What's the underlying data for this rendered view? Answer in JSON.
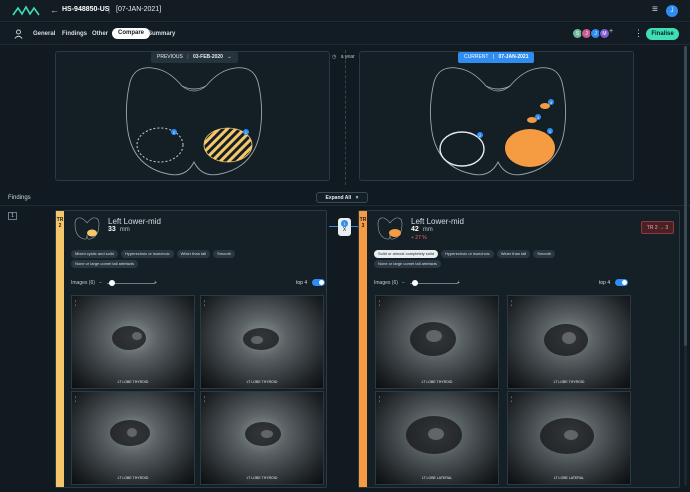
{
  "header": {
    "patient_id": "HS-948850-US",
    "separator": "|",
    "study_date": "[07-JAN-2021]",
    "user_initial": "J"
  },
  "nav": {
    "tabs": [
      {
        "label": "General",
        "active": false
      },
      {
        "label": "Findings",
        "active": false
      },
      {
        "label": "Other",
        "active": false
      },
      {
        "label": "Compare",
        "active": true
      },
      {
        "label": "Summary",
        "active": false
      }
    ],
    "avatars": [
      {
        "initial": "S",
        "color": "#6fb89a"
      },
      {
        "initial": "J",
        "color": "#c85c8e"
      },
      {
        "initial": "J",
        "color": "#2f8cf0"
      },
      {
        "initial": "M",
        "color": "#7a5cd0"
      }
    ],
    "avatars_more": "+",
    "finalise_label": "Finalise"
  },
  "compare": {
    "previous_label": "PREVIOUS",
    "previous_date": "03-FEB-2020",
    "interval_text": "a year",
    "current_label": "CURRENT",
    "current_date": "07-JAN-2021",
    "previous_markers": [
      "2",
      "1"
    ],
    "current_markers": [
      "1",
      "2",
      "3",
      "4"
    ]
  },
  "findings": {
    "title": "Findings",
    "expand_label": "Expand All",
    "index": "1",
    "link_number": "1",
    "link_label": "X",
    "tr_change": "TR 2 → 3",
    "previous": {
      "tirads": "TR 2",
      "location": "Left Lower-mid",
      "size": "33",
      "unit": "mm",
      "tags": [
        "Mixed cystic and solid",
        "Hyperechoic or isoechoic",
        "Wider than tall",
        "Smooth",
        "None or large comet tail artefacts"
      ],
      "images_label": "Images (6)",
      "top_label": "top 4",
      "images": [
        {
          "caption": "LT LOBE THYROID"
        },
        {
          "caption": "LT LOBE THYROID"
        },
        {
          "caption": "LT LOBE THYROID"
        },
        {
          "caption": "LT LOBE THYROID"
        }
      ]
    },
    "current": {
      "tirads": "TR 3",
      "location": "Left Lower-mid",
      "size": "42",
      "unit": "mm",
      "delta": "+ 27 %",
      "tags": [
        "Solid or almost completely solid",
        "Hyperechoic or isoechoic",
        "Wider than tall",
        "Smooth",
        "None or large comet tail artefacts"
      ],
      "images_label": "Images (6)",
      "top_label": "top 4",
      "images": [
        {
          "caption": "LT LOBE THYROID"
        },
        {
          "caption": "LT LOBE THYROID"
        },
        {
          "caption": "LT LOBE LATERAL"
        },
        {
          "caption": "LT LOBE LATERAL"
        }
      ]
    }
  },
  "colors": {
    "accent": "#2f8cf0",
    "finalise": "#3ce0b4",
    "tr2": "#f5c76a",
    "tr3": "#f59b42"
  }
}
